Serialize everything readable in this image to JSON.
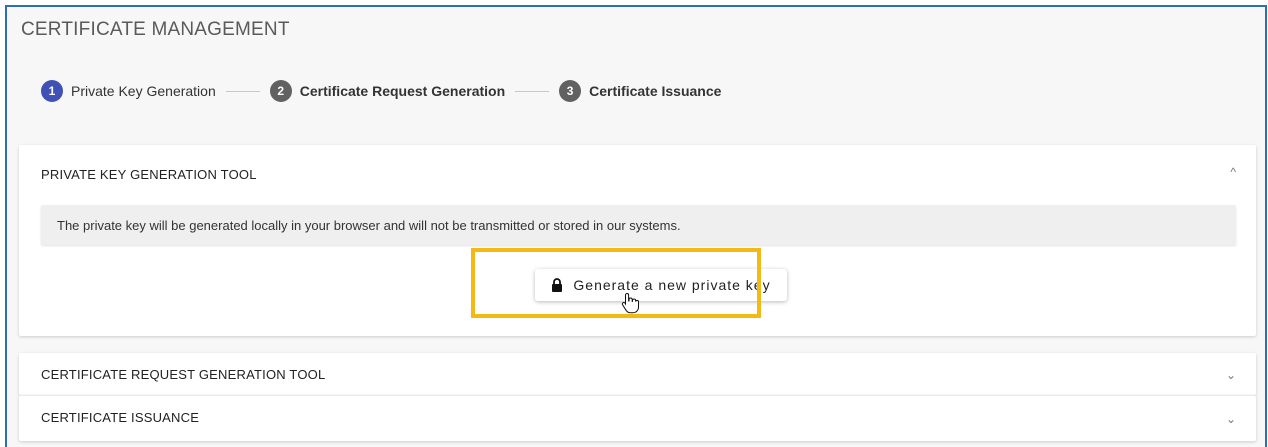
{
  "page": {
    "title": "CERTIFICATE MANAGEMENT"
  },
  "stepper": {
    "steps": [
      {
        "number": "1",
        "label": "Private Key Generation"
      },
      {
        "number": "2",
        "label": "Certificate Request Generation"
      },
      {
        "number": "3",
        "label": "Certificate Issuance"
      }
    ]
  },
  "panels": {
    "private_key": {
      "title": "PRIVATE KEY GENERATION TOOL",
      "chevron": "^",
      "info": "The private key will be generated locally in your browser and will not be transmitted or stored in our systems.",
      "button_label": "Generate a new private key"
    },
    "csr": {
      "title": "CERTIFICATE REQUEST GENERATION TOOL",
      "chevron": "⌄"
    },
    "issuance": {
      "title": "CERTIFICATE ISSUANCE",
      "chevron": "⌄"
    }
  },
  "colors": {
    "accent": "#3f51b5",
    "highlight": "#f5b915",
    "frame_border": "#2e6fb4"
  },
  "icons": {
    "button_icon": "lock-icon",
    "cursor": "hand-pointer-icon"
  }
}
